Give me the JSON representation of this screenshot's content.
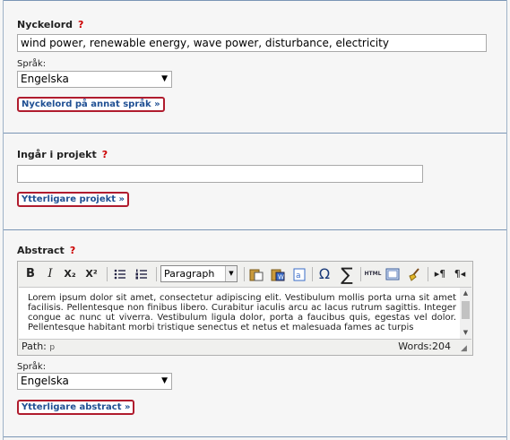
{
  "keywords": {
    "label": "Nyckelord",
    "help": "?",
    "value": "wind power, renewable energy, wave power, disturbance, electricity",
    "lang_label": "Språk:",
    "lang_value": "Engelska",
    "other_lang_button": "Nyckelord på annat språk »"
  },
  "project": {
    "label": "Ingår i projekt",
    "help": "?",
    "value": "",
    "more_button": "Ytterligare projekt »"
  },
  "abstract": {
    "label": "Abstract",
    "help": "?",
    "toolbar": {
      "bold": "B",
      "italic": "I",
      "subscript": "X₂",
      "superscript": "X²",
      "format_value": "Paragraph",
      "html": "HTML"
    },
    "text": "Lorem ipsum dolor sit amet, consectetur adipiscing elit. Vestibulum mollis porta urna sit amet facilisis. Pellentesque non finibus libero. Curabitur iaculis arcu ac lacus rutrum sagittis. Integer congue ac nunc ut viverra. Vestibulum ligula dolor, porta a faucibus quis, egestas vel dolor. Pellentesque habitant morbi tristique senectus et netus et malesuada fames ac turpis",
    "path_label": "Path:",
    "path_value": "p",
    "words": "Words:204",
    "lang_label": "Språk:",
    "lang_value": "Engelska",
    "more_button": "Ytterligare abstract »"
  },
  "colors": {
    "separator": "#7a95b5",
    "button_border": "#b01c2e",
    "button_text": "#1f4f93",
    "help_mark": "#cc0000"
  }
}
